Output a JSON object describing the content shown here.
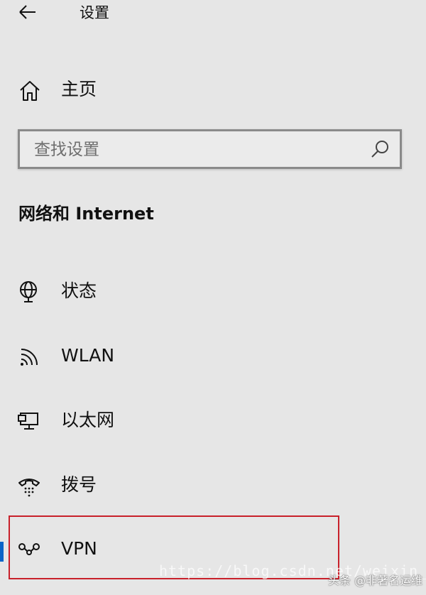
{
  "titlebar": {
    "back_icon": "arrow-left-icon",
    "title": "设置"
  },
  "home": {
    "icon": "home-icon",
    "label": "主页"
  },
  "search": {
    "placeholder": "查找设置",
    "value": "",
    "icon": "search-icon"
  },
  "section": {
    "title": "网络和 Internet"
  },
  "nav": {
    "items": [
      {
        "icon": "globe-status-icon",
        "label": "状态",
        "selected": false
      },
      {
        "icon": "wifi-icon",
        "label": "WLAN",
        "selected": false
      },
      {
        "icon": "ethernet-icon",
        "label": "以太网",
        "selected": false
      },
      {
        "icon": "dialup-icon",
        "label": "拨号",
        "selected": false
      },
      {
        "icon": "vpn-icon",
        "label": "VPN",
        "selected": true
      }
    ]
  },
  "colors": {
    "background": "#e6e6e6",
    "accent": "#0a64c8",
    "highlight_border": "#c8202a"
  },
  "watermark": {
    "source": "头条 @非著名运维"
  }
}
